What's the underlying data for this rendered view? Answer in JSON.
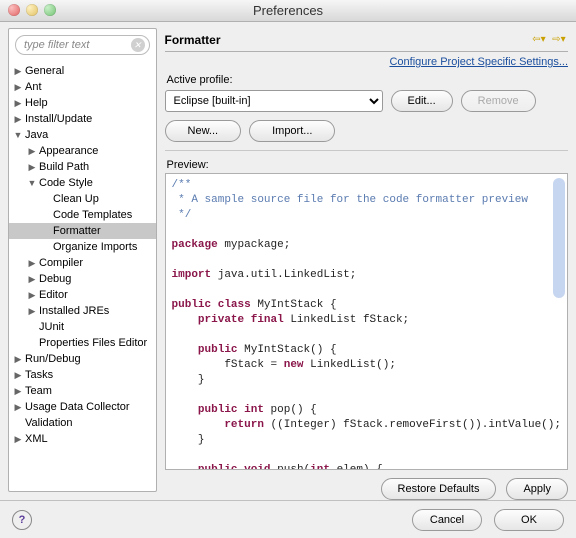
{
  "window": {
    "title": "Preferences"
  },
  "sidebar": {
    "filter_placeholder": "type filter text",
    "nodes": [
      {
        "label": "General",
        "indent": 0,
        "arrow": "▶",
        "sel": false
      },
      {
        "label": "Ant",
        "indent": 0,
        "arrow": "▶",
        "sel": false
      },
      {
        "label": "Help",
        "indent": 0,
        "arrow": "▶",
        "sel": false
      },
      {
        "label": "Install/Update",
        "indent": 0,
        "arrow": "▶",
        "sel": false
      },
      {
        "label": "Java",
        "indent": 0,
        "arrow": "▼",
        "sel": false
      },
      {
        "label": "Appearance",
        "indent": 1,
        "arrow": "▶",
        "sel": false
      },
      {
        "label": "Build Path",
        "indent": 1,
        "arrow": "▶",
        "sel": false
      },
      {
        "label": "Code Style",
        "indent": 1,
        "arrow": "▼",
        "sel": false
      },
      {
        "label": "Clean Up",
        "indent": 2,
        "arrow": "",
        "sel": false
      },
      {
        "label": "Code Templates",
        "indent": 2,
        "arrow": "",
        "sel": false
      },
      {
        "label": "Formatter",
        "indent": 2,
        "arrow": "",
        "sel": true
      },
      {
        "label": "Organize Imports",
        "indent": 2,
        "arrow": "",
        "sel": false
      },
      {
        "label": "Compiler",
        "indent": 1,
        "arrow": "▶",
        "sel": false
      },
      {
        "label": "Debug",
        "indent": 1,
        "arrow": "▶",
        "sel": false
      },
      {
        "label": "Editor",
        "indent": 1,
        "arrow": "▶",
        "sel": false
      },
      {
        "label": "Installed JREs",
        "indent": 1,
        "arrow": "▶",
        "sel": false
      },
      {
        "label": "JUnit",
        "indent": 1,
        "arrow": "",
        "sel": false
      },
      {
        "label": "Properties Files Editor",
        "indent": 1,
        "arrow": "",
        "sel": false
      },
      {
        "label": "Run/Debug",
        "indent": 0,
        "arrow": "▶",
        "sel": false
      },
      {
        "label": "Tasks",
        "indent": 0,
        "arrow": "▶",
        "sel": false
      },
      {
        "label": "Team",
        "indent": 0,
        "arrow": "▶",
        "sel": false
      },
      {
        "label": "Usage Data Collector",
        "indent": 0,
        "arrow": "▶",
        "sel": false
      },
      {
        "label": "Validation",
        "indent": 0,
        "arrow": "",
        "sel": false
      },
      {
        "label": "XML",
        "indent": 0,
        "arrow": "▶",
        "sel": false
      }
    ]
  },
  "page": {
    "title": "Formatter",
    "link": "Configure Project Specific Settings...",
    "active_profile_label": "Active profile:",
    "active_profile_value": "Eclipse [built-in]",
    "edit": "Edit...",
    "remove": "Remove",
    "new": "New...",
    "import": "Import...",
    "preview_label": "Preview:",
    "restore": "Restore Defaults",
    "apply": "Apply"
  },
  "bottom": {
    "help": "?",
    "cancel": "Cancel",
    "ok": "OK"
  },
  "preview_code": {
    "l1": "/**",
    "l2": " * A sample source file for the code formatter preview",
    "l3": " */",
    "l4": "",
    "l5a": "package",
    "l5b": " mypackage;",
    "l6": "",
    "l7a": "import",
    "l7b": " java.util.LinkedList;",
    "l8": "",
    "l9a": "public class",
    "l9b": " MyIntStack {",
    "l10a": "    private final",
    "l10b": " LinkedList fStack;",
    "l11": "",
    "l12a": "    public",
    "l12b": " MyIntStack() {",
    "l13a": "        fStack = ",
    "l13b": "new",
    "l13c": " LinkedList();",
    "l14": "    }",
    "l15": "",
    "l16a": "    public int",
    "l16b": " pop() {",
    "l17a": "        return",
    "l17b": " ((Integer) fStack.removeFirst()).intValue();",
    "l18": "    }",
    "l19": "",
    "l20a": "    public void",
    "l20b": " push(",
    "l20c": "int",
    "l20d": " elem) {"
  }
}
